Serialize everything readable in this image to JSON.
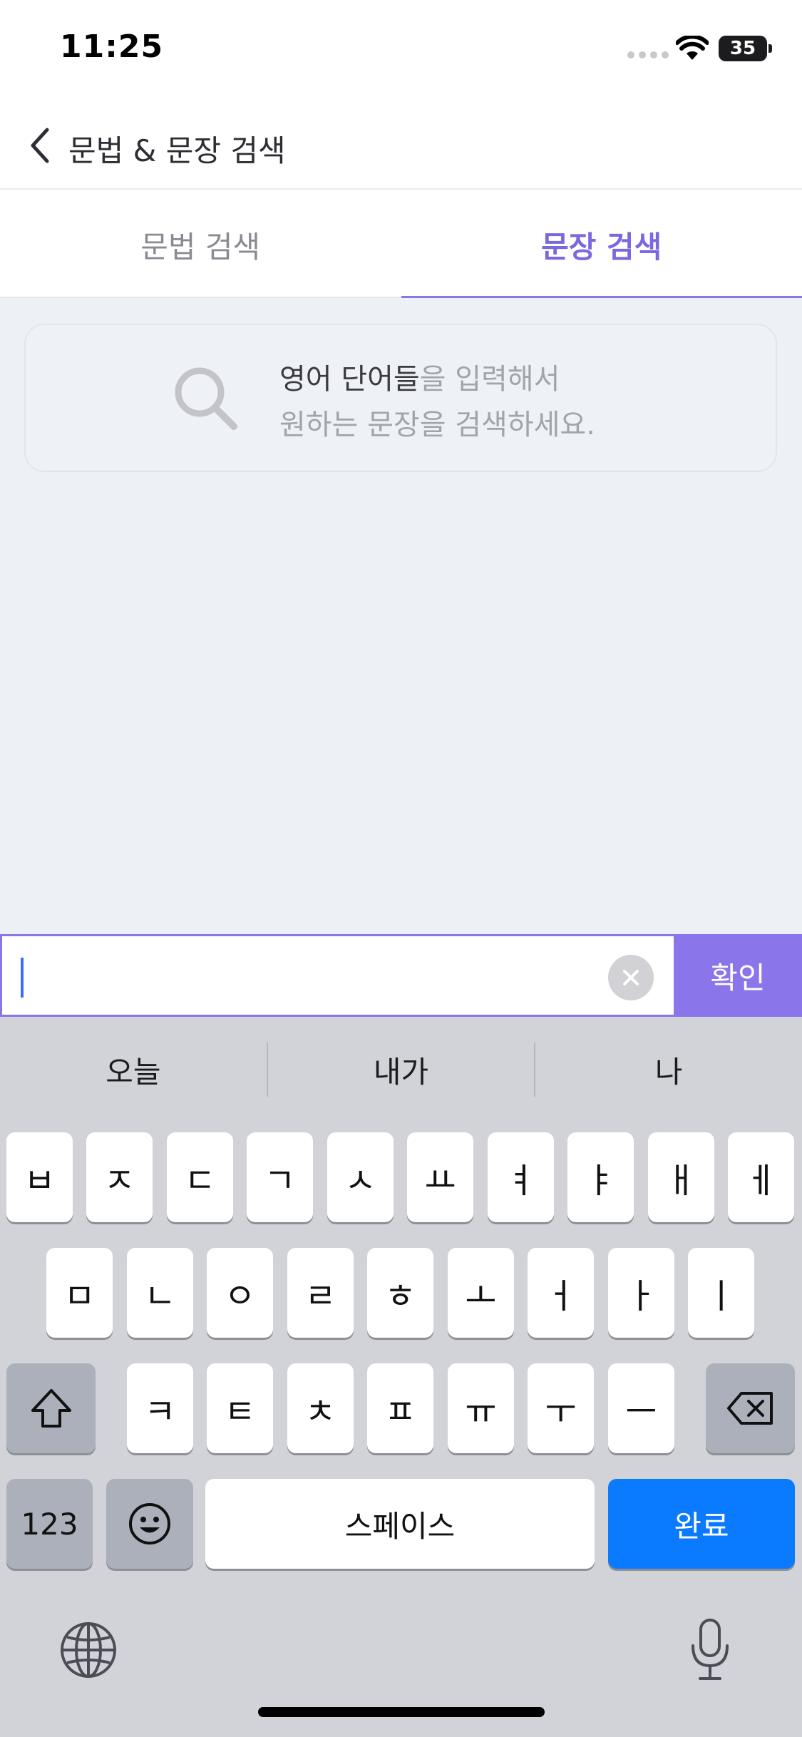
{
  "status_bar": {
    "time": "11:25",
    "battery": "35"
  },
  "header": {
    "title": "문법 & 문장 검색"
  },
  "tabs": [
    {
      "label": "문법 검색",
      "active": false
    },
    {
      "label": "문장 검색",
      "active": true
    }
  ],
  "hint": {
    "line1_strong": "영어 단어들",
    "line1_rest": "을 입력해서",
    "line2": "원하는 문장을 검색하세요."
  },
  "search": {
    "value": "",
    "confirm_label": "확인"
  },
  "keyboard": {
    "suggestions": [
      "오늘",
      "내가",
      "나"
    ],
    "row1": [
      "ㅂ",
      "ㅈ",
      "ㄷ",
      "ㄱ",
      "ㅅ",
      "ㅛ",
      "ㅕ",
      "ㅑ",
      "ㅐ",
      "ㅔ"
    ],
    "row2": [
      "ㅁ",
      "ㄴ",
      "ㅇ",
      "ㄹ",
      "ㅎ",
      "ㅗ",
      "ㅓ",
      "ㅏ",
      "ㅣ"
    ],
    "row3": [
      "ㅋ",
      "ㅌ",
      "ㅊ",
      "ㅍ",
      "ㅠ",
      "ㅜ",
      "ㅡ"
    ],
    "numbers_label": "123",
    "space_label": "스페이스",
    "done_label": "완료"
  },
  "colors": {
    "accent": "#8a76ea",
    "active_tab": "#7a68e0",
    "content_bg": "#edf0f5",
    "done_key": "#0a7aff"
  }
}
